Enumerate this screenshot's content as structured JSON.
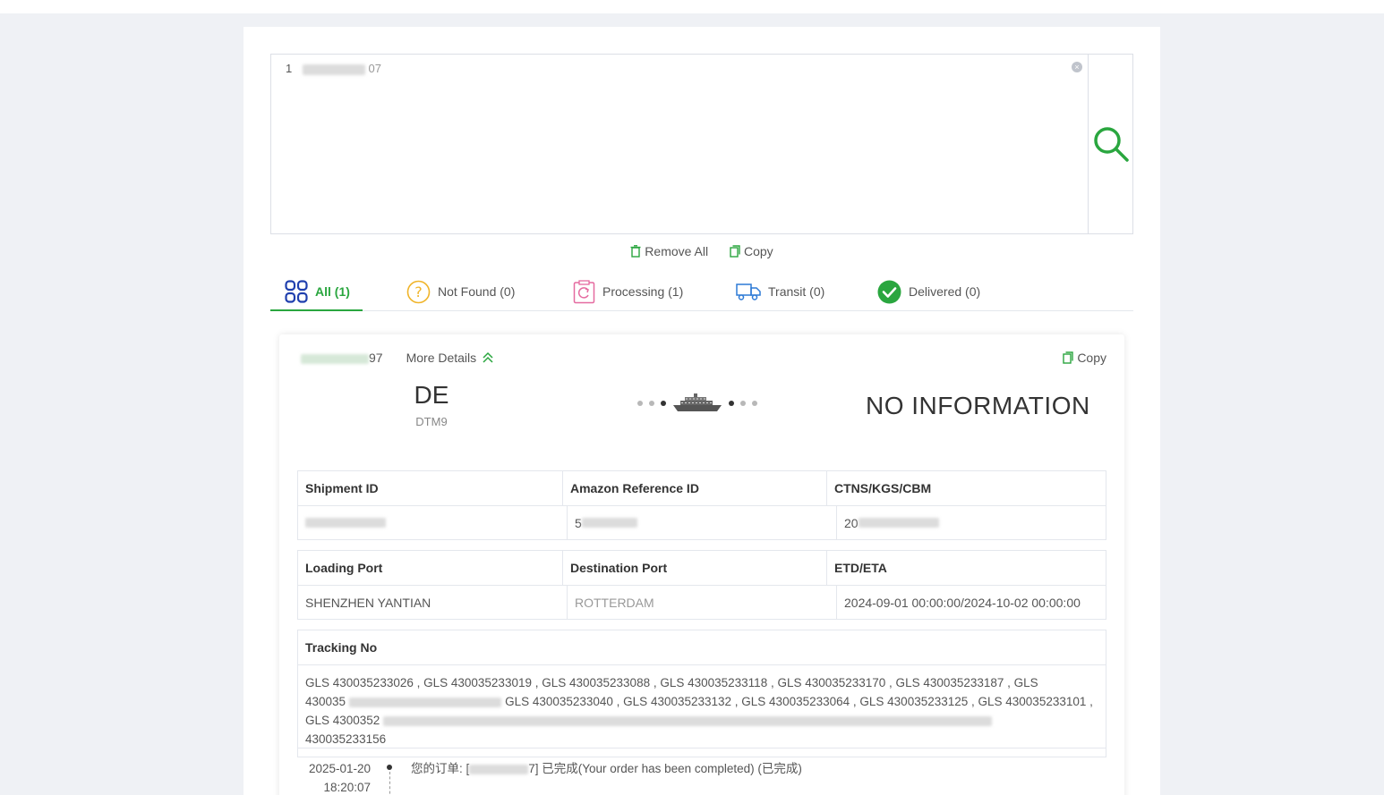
{
  "search": {
    "prefix": "1",
    "suffix": "07"
  },
  "actions": {
    "remove_all": "Remove All",
    "copy": "Copy"
  },
  "tabs": [
    {
      "label": "All (1)",
      "icon": "grid-icon"
    },
    {
      "label": "Not Found (0)",
      "icon": "question-icon"
    },
    {
      "label": "Processing (1)",
      "icon": "processing-icon"
    },
    {
      "label": "Transit (0)",
      "icon": "truck-icon"
    },
    {
      "label": "Delivered (0)",
      "icon": "check-circle-icon"
    }
  ],
  "card": {
    "tracking_suffix": "97",
    "more_details": "More Details",
    "copy": "Copy",
    "destination_code": "DE",
    "destination_sub": "DTM9",
    "status": "NO INFORMATION",
    "table1": {
      "headers": [
        "Shipment ID",
        "Amazon Reference ID",
        "CTNS/KGS/CBM"
      ],
      "values": [
        "FBA15...",
        "5",
        "20"
      ]
    },
    "table2": {
      "headers": [
        "Loading Port",
        "Destination Port",
        "ETD/ETA"
      ],
      "values": [
        "SHENZHEN YANTIAN",
        "ROTTERDAM",
        "2024-09-01 00:00:00/2024-10-02 00:00:00"
      ]
    },
    "tracking_no": {
      "header": "Tracking No",
      "line1": "GLS 430035233026 , GLS 430035233019 , GLS 430035233088 , GLS 430035233118 , GLS 430035233170 , GLS 430035233187 , GLS",
      "line2_a": "430035",
      "line2_b": "GLS 430035233040 , GLS 430035233132 , GLS 430035233064 , GLS 430035233125 , GLS 430035233101 ,",
      "line3": "GLS 4300352",
      "line4": "430035233156"
    },
    "timeline": [
      {
        "date": "2025-01-20",
        "time": "18:20:07",
        "text_a": "您的订单: [",
        "text_b": "7] 已完成(Your order has been completed) (已完成)"
      }
    ]
  },
  "colors": {
    "accent": "#2aa63f",
    "grid_icon": "#1f3fae",
    "question_icon": "#f0b429",
    "processing_icon": "#e56aa0",
    "truck_icon": "#2d7ad6"
  }
}
